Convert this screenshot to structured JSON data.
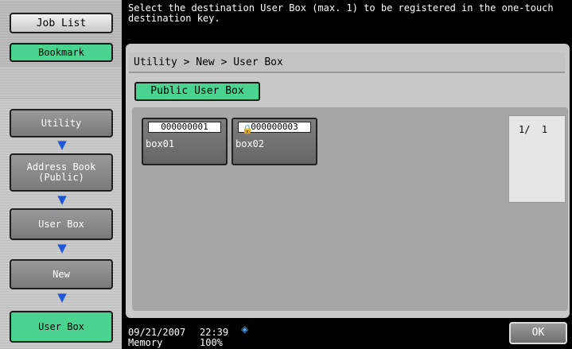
{
  "sidebar": {
    "job_list": "Job List",
    "bookmark": "Bookmark",
    "flow": [
      "Utility",
      "Address Book\n(Public)",
      "User Box",
      "New",
      "User Box"
    ]
  },
  "message": "Select the destination User Box (max. 1) to be registered in the one-touch destination key.",
  "breadcrumb": "Utility > New > User Box",
  "tab": "Public User Box",
  "boxes": [
    {
      "number": "000000001",
      "name": "box01",
      "locked": false
    },
    {
      "number": "000000003",
      "name": "box02",
      "locked": true
    }
  ],
  "pager": "1/  1",
  "status": {
    "date": "09/21/2007",
    "time": "22:39",
    "memory_label": "Memory",
    "memory_value": "100%"
  },
  "ok_label": "OK",
  "icons": {
    "arrow": "arrow-down-icon",
    "lock": "lock-icon",
    "network": "network-icon"
  },
  "colors": {
    "green": "#49d38f",
    "arrow": "#1e58d8"
  }
}
